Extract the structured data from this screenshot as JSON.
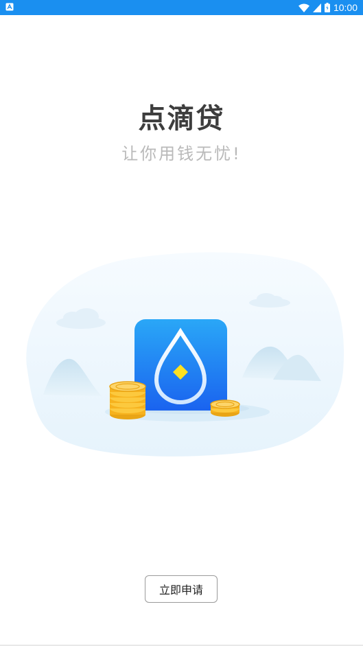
{
  "status_bar": {
    "time": "10:00",
    "icons": [
      "notification-icon",
      "wifi-icon",
      "signal-icon",
      "battery-icon"
    ],
    "background": "#1a8ff0"
  },
  "app": {
    "title": "点滴贷",
    "slogan": "让你用钱无忧!"
  },
  "illustration": {
    "icons": [
      "water-drop-app-icon",
      "coin-stack-icon",
      "mountain-landscape"
    ],
    "accent_color": "#1d6ff5",
    "coin_color": "#f6b21e"
  },
  "actions": {
    "apply_label": "立即申请"
  }
}
